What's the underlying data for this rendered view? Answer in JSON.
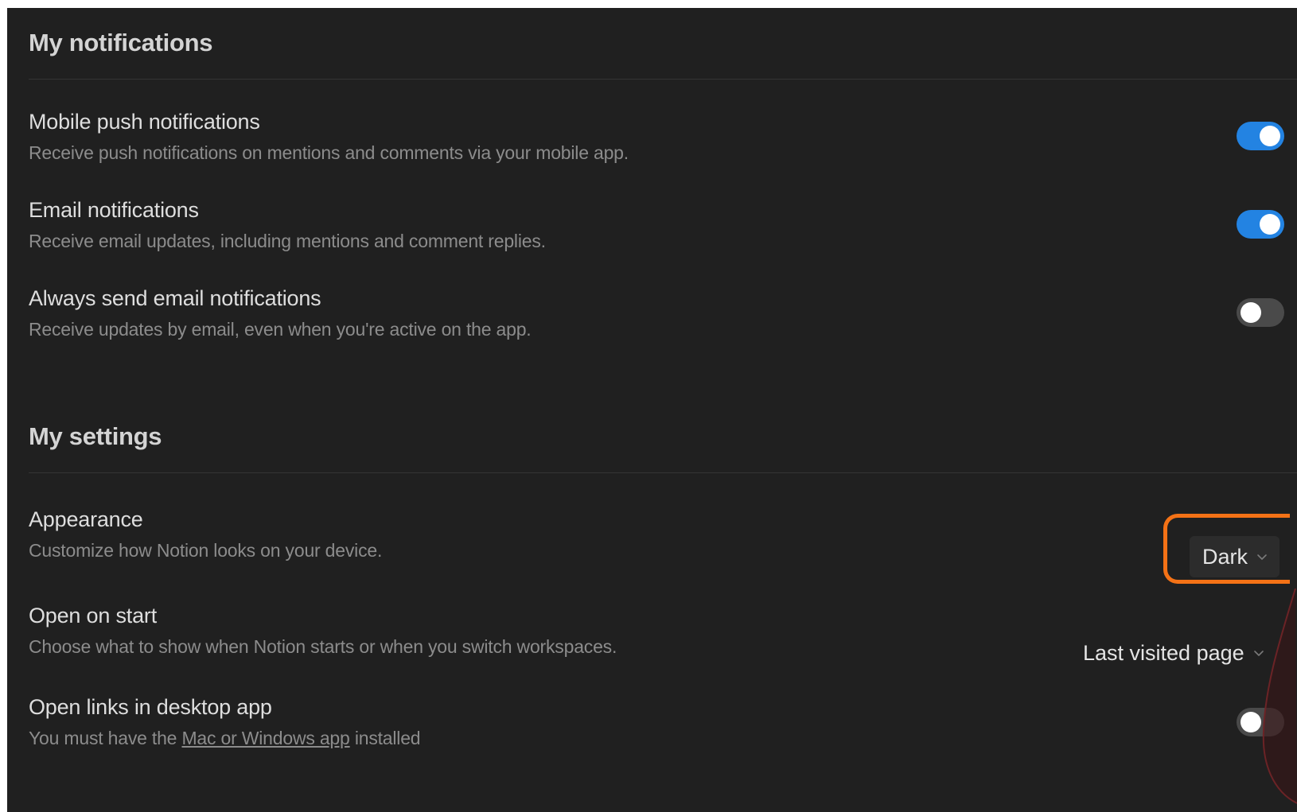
{
  "notifications": {
    "title": "My notifications",
    "items": [
      {
        "label": "Mobile push notifications",
        "description": "Receive push notifications on mentions and comments via your mobile app.",
        "enabled": true
      },
      {
        "label": "Email notifications",
        "description": "Receive email updates, including mentions and comment replies.",
        "enabled": true
      },
      {
        "label": "Always send email notifications",
        "description": "Receive updates by email, even when you're active on the app.",
        "enabled": false
      }
    ]
  },
  "settings": {
    "title": "My settings",
    "appearance": {
      "label": "Appearance",
      "description": "Customize how Notion looks on your device.",
      "value": "Dark"
    },
    "open_on_start": {
      "label": "Open on start",
      "description": "Choose what to show when Notion starts or when you switch workspaces.",
      "value": "Last visited page"
    },
    "open_links": {
      "label": "Open links in desktop app",
      "description_prefix": "You must have the ",
      "link_text": "Mac or Windows app",
      "description_suffix": " installed",
      "enabled": false
    }
  },
  "colors": {
    "background": "#202020",
    "toggle_on": "#2383e2",
    "toggle_off": "#4a4a4a",
    "highlight": "#f47216",
    "annotation_stroke": "#6b2326"
  },
  "icons": {
    "select_chevron": "chevron-down-icon"
  }
}
